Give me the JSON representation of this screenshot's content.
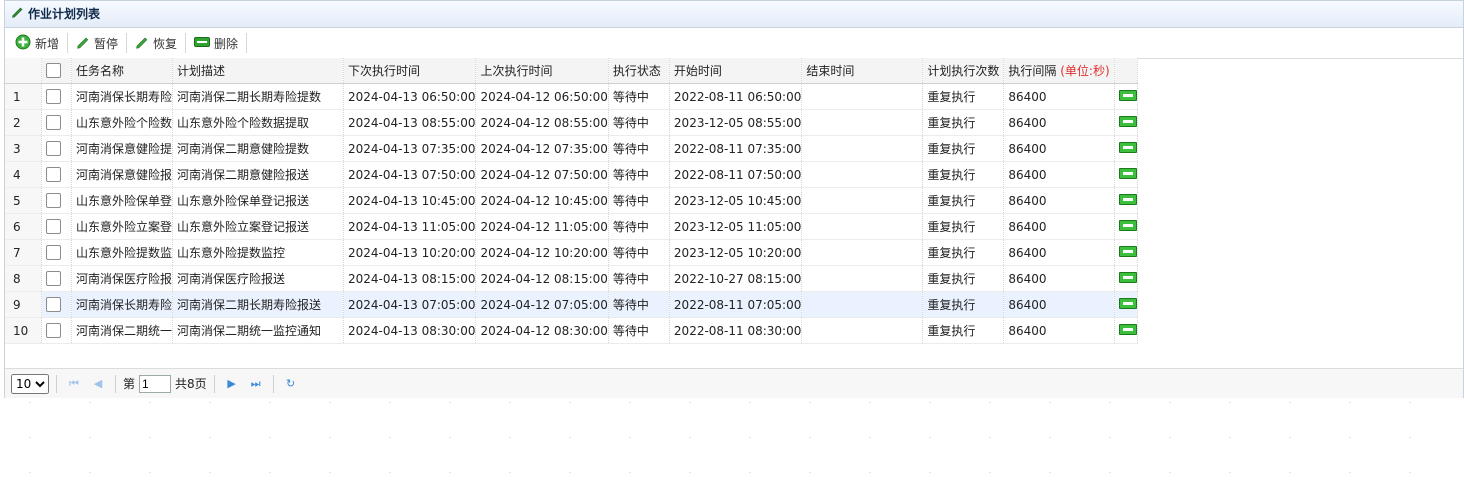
{
  "panel": {
    "title": "作业计划列表"
  },
  "toolbar": {
    "add": "新增",
    "pause": "暂停",
    "resume": "恢复",
    "delete": "删除"
  },
  "table": {
    "columns": [
      "任务名称",
      "计划描述",
      "下次执行时间",
      "上次执行时间",
      "执行状态",
      "开始时间",
      "结束时间",
      "计划执行次数",
      "执行间隔"
    ],
    "interval_unit": "(单位:秒)",
    "rows": [
      {
        "n": "1",
        "name": "河南消保长期寿险",
        "desc": "河南消保二期长期寿险提数",
        "next": "2024-04-13 06:50:00",
        "last": "2024-04-12 06:50:00",
        "status": "等待中",
        "start": "2022-08-11 06:50:00",
        "end": "",
        "count": "重复执行",
        "interval": "86400"
      },
      {
        "n": "2",
        "name": "山东意外险个险数",
        "desc": "山东意外险个险数据提取",
        "next": "2024-04-13 08:55:00",
        "last": "2024-04-12 08:55:00",
        "status": "等待中",
        "start": "2023-12-05 08:55:00",
        "end": "",
        "count": "重复执行",
        "interval": "86400"
      },
      {
        "n": "3",
        "name": "河南消保意健险提",
        "desc": "河南消保二期意健险提数",
        "next": "2024-04-13 07:35:00",
        "last": "2024-04-12 07:35:00",
        "status": "等待中",
        "start": "2022-08-11 07:35:00",
        "end": "",
        "count": "重复执行",
        "interval": "86400"
      },
      {
        "n": "4",
        "name": "河南消保意健险报",
        "desc": "河南消保二期意健险报送",
        "next": "2024-04-13 07:50:00",
        "last": "2024-04-12 07:50:00",
        "status": "等待中",
        "start": "2022-08-11 07:50:00",
        "end": "",
        "count": "重复执行",
        "interval": "86400"
      },
      {
        "n": "5",
        "name": "山东意外险保单登",
        "desc": "山东意外险保单登记报送",
        "next": "2024-04-13 10:45:00",
        "last": "2024-04-12 10:45:00",
        "status": "等待中",
        "start": "2023-12-05 10:45:00",
        "end": "",
        "count": "重复执行",
        "interval": "86400"
      },
      {
        "n": "6",
        "name": "山东意外险立案登",
        "desc": "山东意外险立案登记报送",
        "next": "2024-04-13 11:05:00",
        "last": "2024-04-12 11:05:00",
        "status": "等待中",
        "start": "2023-12-05 11:05:00",
        "end": "",
        "count": "重复执行",
        "interval": "86400"
      },
      {
        "n": "7",
        "name": "山东意外险提数监",
        "desc": "山东意外险提数监控",
        "next": "2024-04-13 10:20:00",
        "last": "2024-04-12 10:20:00",
        "status": "等待中",
        "start": "2023-12-05 10:20:00",
        "end": "",
        "count": "重复执行",
        "interval": "86400"
      },
      {
        "n": "8",
        "name": "河南消保医疗险报",
        "desc": "河南消保医疗险报送",
        "next": "2024-04-13 08:15:00",
        "last": "2024-04-12 08:15:00",
        "status": "等待中",
        "start": "2022-10-27 08:15:00",
        "end": "",
        "count": "重复执行",
        "interval": "86400"
      },
      {
        "n": "9",
        "name": "河南消保长期寿险",
        "desc": "河南消保二期长期寿险报送",
        "next": "2024-04-13 07:05:00",
        "last": "2024-04-12 07:05:00",
        "status": "等待中",
        "start": "2022-08-11 07:05:00",
        "end": "",
        "count": "重复执行",
        "interval": "86400"
      },
      {
        "n": "10",
        "name": "河南消保二期统一",
        "desc": "河南消保二期统一监控通知",
        "next": "2024-04-13 08:30:00",
        "last": "2024-04-12 08:30:00",
        "status": "等待中",
        "start": "2022-08-11 08:30:00",
        "end": "",
        "count": "重复执行",
        "interval": "86400"
      }
    ],
    "selected_row": 9
  },
  "pager": {
    "page_size": "10",
    "page_label": "第",
    "page_value": "1",
    "total": "共8页"
  },
  "colors": {
    "accent": "#3a88d8",
    "unit_red": "#e03030",
    "header_bg": "#e3ecf8",
    "selected_row_bg": "#eaf2ff"
  },
  "icons": {
    "title": "pencil-icon",
    "add": "plus-circle-icon",
    "pause": "pencil-icon",
    "resume": "pencil-icon",
    "delete": "minus-bar-icon",
    "row_action": "edit-bar-icon"
  }
}
